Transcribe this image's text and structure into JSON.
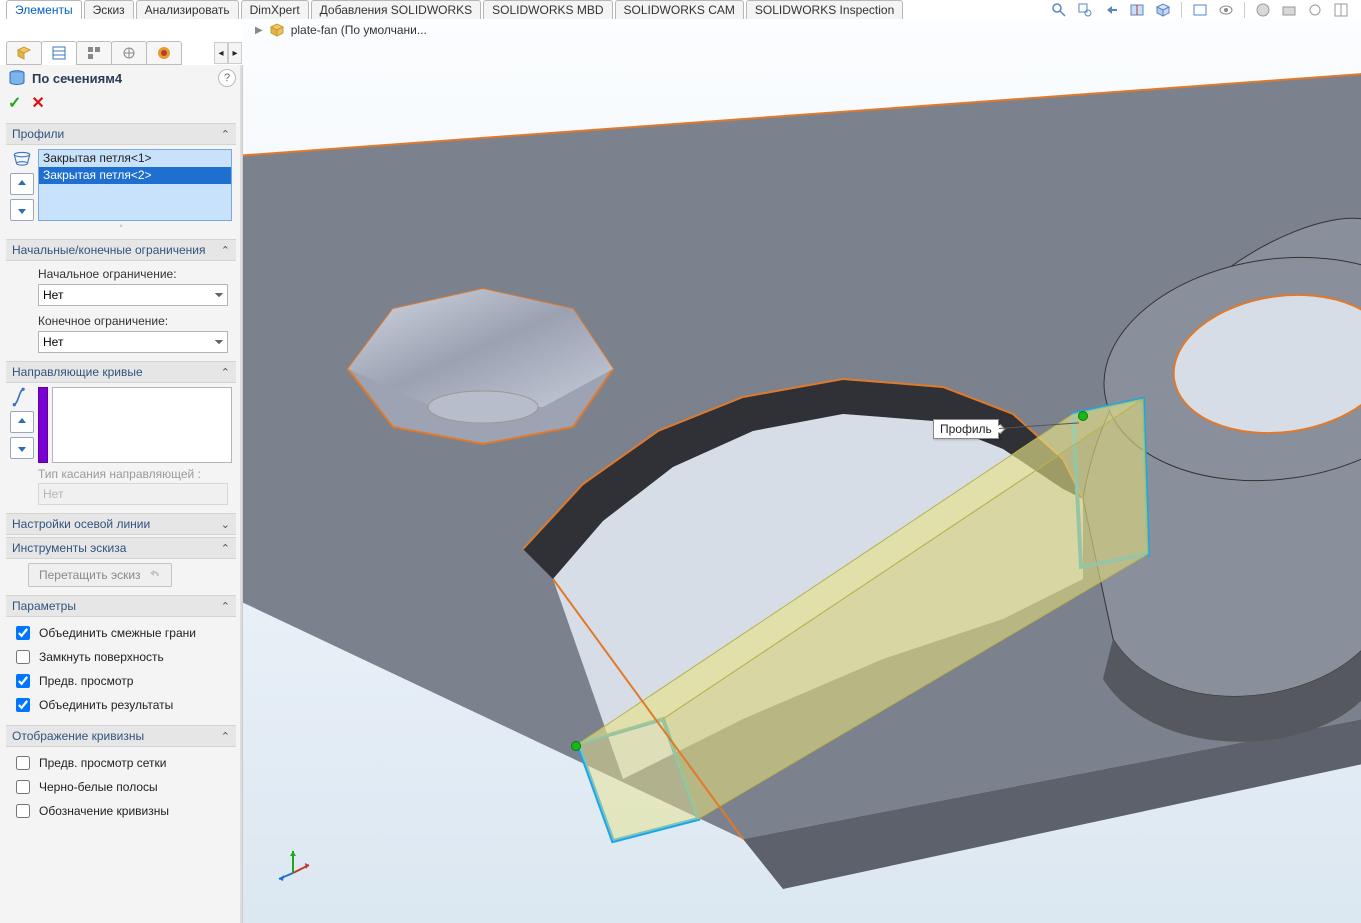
{
  "colors": {
    "accent": "#1f6fd1",
    "loft_purple": "#7a00d4",
    "ok_green": "#1fa81f",
    "cancel_red": "#d11"
  },
  "cm_tabs": [
    {
      "label": "Элементы",
      "active": true
    },
    {
      "label": "Эскиз"
    },
    {
      "label": "Анализировать"
    },
    {
      "label": "DimXpert"
    },
    {
      "label": "Добавления SOLIDWORKS"
    },
    {
      "label": "SOLIDWORKS MBD"
    },
    {
      "label": "SOLIDWORKS CAM"
    },
    {
      "label": "SOLIDWORKS Inspection"
    }
  ],
  "view_toolbar": [
    "zoom-fit-icon",
    "zoom-area-icon",
    "previous-view-icon",
    "section-view-icon",
    "view-orientation-icon",
    "display-style-icon",
    "hide-show-icon",
    "edit-appearance-icon",
    "scene-icon",
    "view-settings-icon",
    "render-icon",
    "display-pane-icon"
  ],
  "breadcrumb": {
    "part_name": "plate-fan  (По умолчани..."
  },
  "fm_tabs": [
    {
      "name": "feature-manager-icon"
    },
    {
      "name": "property-manager-icon",
      "active": true
    },
    {
      "name": "configuration-manager-icon"
    },
    {
      "name": "dimxpert-manager-icon"
    },
    {
      "name": "display-manager-icon"
    },
    {
      "name": "cam-manager-icon"
    }
  ],
  "pm": {
    "title": "По сечениям4",
    "help_tooltip": "?",
    "ok_label": "✓",
    "cancel_label": "✕",
    "profiles": {
      "header": "Профили",
      "items": [
        {
          "label": "Закрытая петля<1>",
          "selected": false
        },
        {
          "label": "Закрытая петля<2>",
          "selected": true
        }
      ]
    },
    "constraints": {
      "header": "Начальные/конечные ограничения",
      "start_label": "Начальное ограничение:",
      "start_value": "Нет",
      "end_label": "Конечное ограничение:",
      "end_value": "Нет"
    },
    "guides": {
      "header": "Направляющие кривые",
      "tangency_label": "Тип касания направляющей :",
      "tangency_value": "Нет"
    },
    "centerline": {
      "header": "Настройки осевой линии"
    },
    "sketch_tools": {
      "header": "Инструменты эскиза",
      "drag_btn": "Перетащить эскиз"
    },
    "options": {
      "header": "Параметры",
      "merge_faces": {
        "label": "Объединить смежные грани",
        "checked": true
      },
      "close_surface": {
        "label": "Замкнуть поверхность",
        "checked": false
      },
      "preview": {
        "label": "Предв. просмотр",
        "checked": true
      },
      "merge_result": {
        "label": "Объединить результаты",
        "checked": true
      }
    },
    "curvature": {
      "header": "Отображение кривизны",
      "mesh_preview": {
        "label": "Предв. просмотр сетки",
        "checked": false
      },
      "zebra": {
        "label": "Черно-белые полосы",
        "checked": false
      },
      "curv_mark": {
        "label": "Обозначение кривизны",
        "checked": false
      }
    }
  },
  "viewport": {
    "callout_label": "Профиль"
  }
}
